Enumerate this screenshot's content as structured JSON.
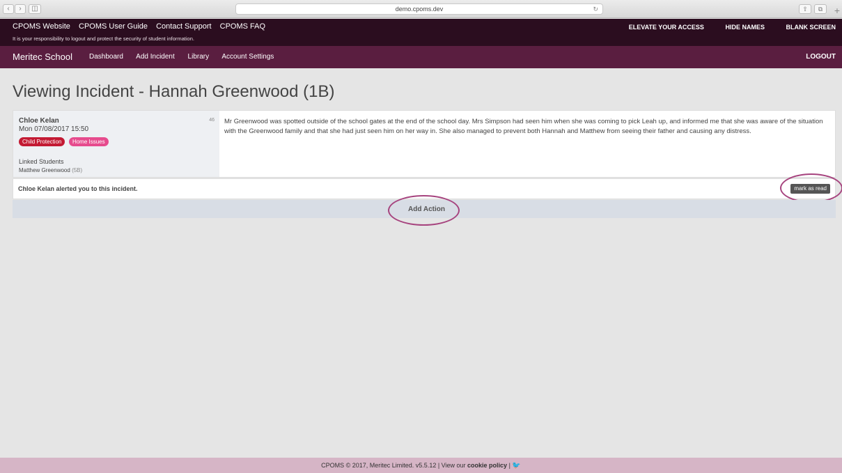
{
  "browser": {
    "url": "demo.cpoms.dev",
    "back_icon": "chevron-left",
    "forward_icon": "chevron-right",
    "reload_icon": "reload"
  },
  "topbar": {
    "links": [
      "CPOMS Website",
      "CPOMS User Guide",
      "Contact Support",
      "CPOMS FAQ"
    ],
    "notice": "It is your responsibility to logout and protect the security of student information.",
    "right_links": [
      "ELEVATE YOUR ACCESS",
      "HIDE NAMES",
      "BLANK SCREEN"
    ]
  },
  "navbar": {
    "brand": "Meritec School",
    "links": [
      "Dashboard",
      "Add Incident",
      "Library",
      "Account Settings"
    ],
    "logout": "LOGOUT"
  },
  "page": {
    "title": "Viewing Incident - Hannah Greenwood (1B)"
  },
  "incident": {
    "author": "Chloe Kelan",
    "date": "Mon 07/08/2017 15:50",
    "number": "46",
    "tags": [
      "Child Protection",
      "Home Issues"
    ],
    "linked_students_label": "Linked Students",
    "linked_student_name": "Matthew Greenwood",
    "linked_student_class": "(5B)",
    "text": "Mr Greenwood was spotted outside of the school gates at the end of the school day. Mrs Simpson had seen him when she was coming to pick Leah up, and informed me that she was aware of the situation with the Greenwood family and that she had just seen him on her way in. She also managed to prevent both Hannah and Matthew from seeing their father and causing any distress."
  },
  "alert": {
    "message": "Chloe Kelan alerted you to this incident.",
    "mark_read": "mark as read"
  },
  "actions": {
    "add_action": "Add Action"
  },
  "footer": {
    "prefix": "CPOMS © 2017, Meritec Limited. v5.5.12 | View our ",
    "cookie": "cookie policy",
    "suffix": " | "
  },
  "colors": {
    "topbar": "#2b0d1f",
    "navbar": "#5a1e40",
    "tag_child_protection": "#c31a33",
    "tag_home_issues": "#e64b8d",
    "highlight_circle": "#a6437e",
    "footer": "#d6b5c6"
  }
}
